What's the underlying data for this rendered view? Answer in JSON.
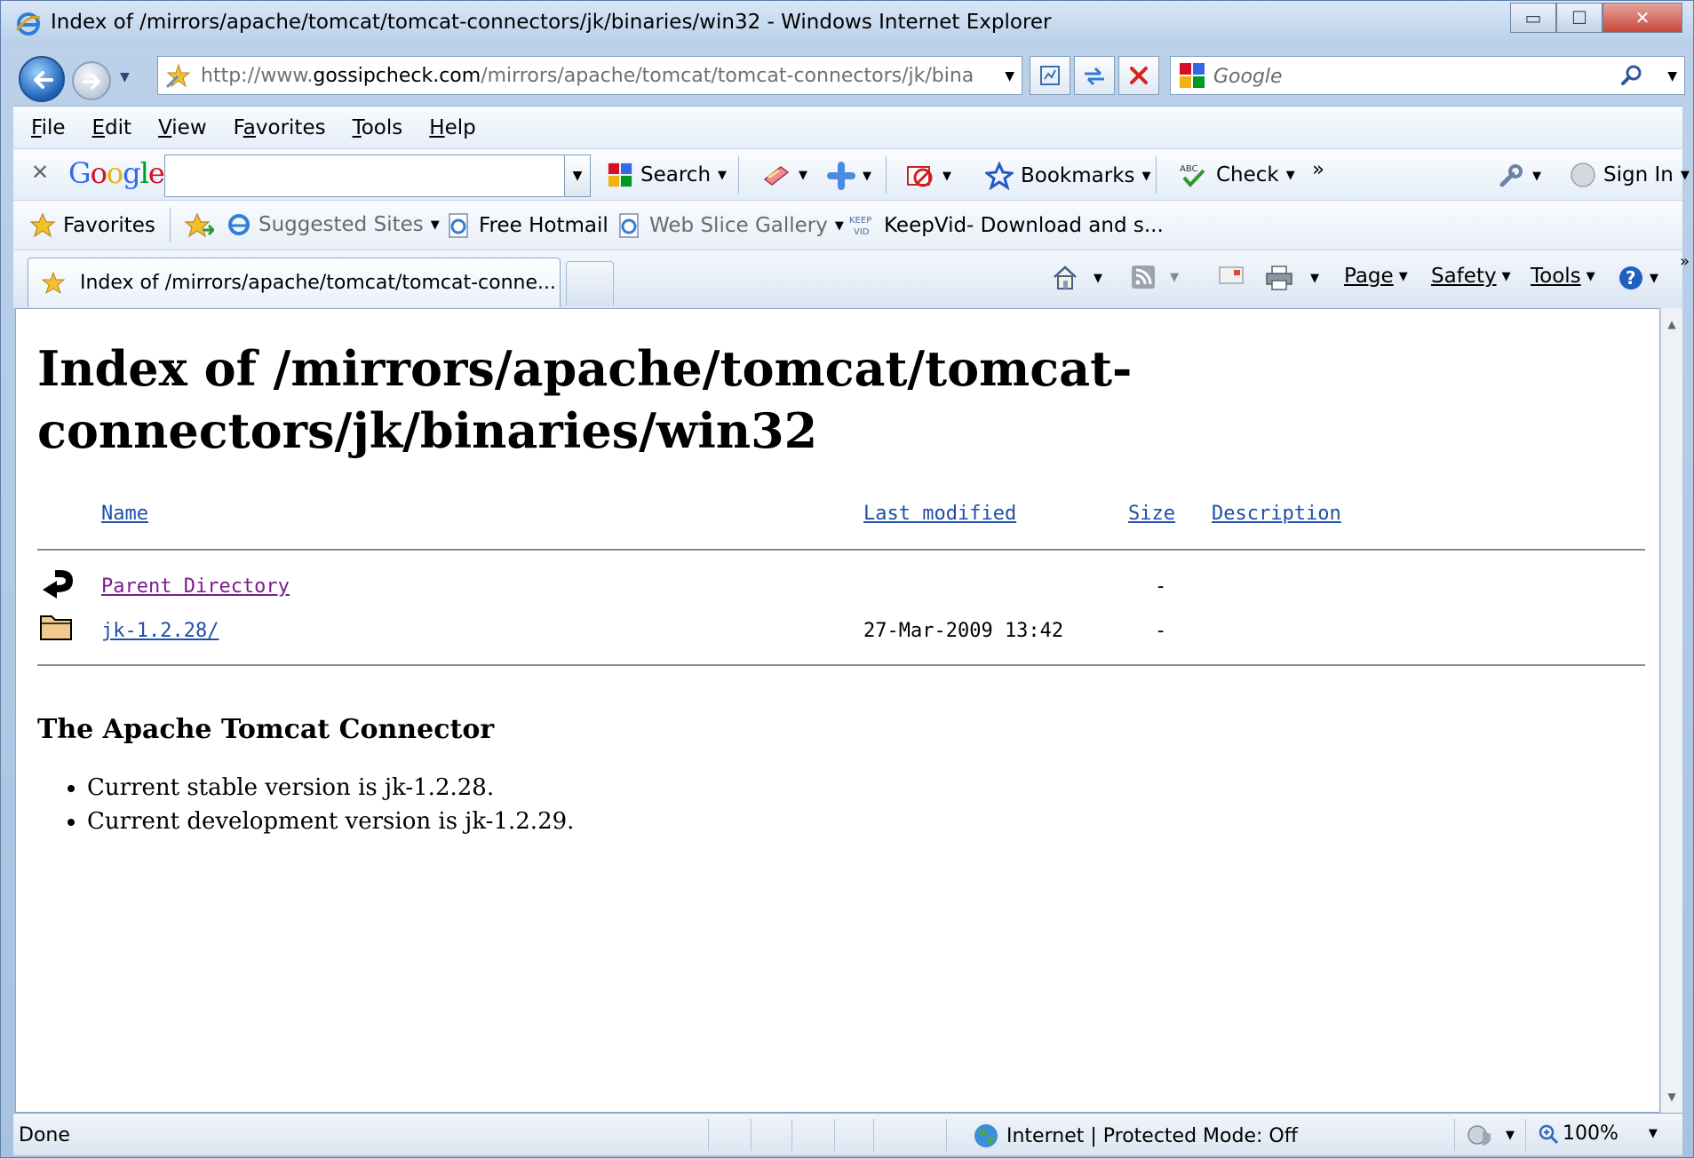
{
  "window": {
    "title": "Index of /mirrors/apache/tomcat/tomcat-connectors/jk/binaries/win32 - Windows Internet Explorer",
    "controls": {
      "minimize": "▭",
      "maximize": "☐",
      "close": "✕"
    }
  },
  "address": {
    "url_prefix": "http://www.",
    "url_host": "gossipcheck.com",
    "url_path": "/mirrors/apache/tomcat/tomcat-connectors/jk/binarie"
  },
  "search": {
    "placeholder": "Google"
  },
  "menu": [
    {
      "label": "File",
      "u": "F",
      "rest": "ile"
    },
    {
      "label": "Edit",
      "u": "E",
      "rest": "dit"
    },
    {
      "label": "View",
      "u": "V",
      "rest": "iew"
    },
    {
      "label": "Favorites",
      "u": "a",
      "pre": "F",
      "rest": "vorites"
    },
    {
      "label": "Tools",
      "u": "T",
      "rest": "ools"
    },
    {
      "label": "Help",
      "u": "H",
      "rest": "elp"
    }
  ],
  "google_toolbar": {
    "close": "✕",
    "logo": [
      "G",
      "o",
      "o",
      "g",
      "l",
      "e"
    ],
    "search_label": "Search",
    "bookmarks_label": "Bookmarks",
    "check_label": "Check",
    "more": "»",
    "sign_in_label": "Sign In"
  },
  "favorites_bar": {
    "favorites_label": "Favorites",
    "suggested_sites": "Suggested Sites",
    "free_hotmail": "Free Hotmail",
    "web_slice_gallery": "Web Slice Gallery",
    "keepvid": "KeepVid- Download and s..."
  },
  "tab": {
    "active_label": "Index of /mirrors/apache/tomcat/tomcat-conne..."
  },
  "command_bar": {
    "page_label": "Page",
    "safety_label": "Safety",
    "tools_label": "Tools",
    "more": "»"
  },
  "page": {
    "title_line1": "Index of /mirrors/apache/tomcat/tomcat-",
    "title_line2": "connectors/jk/binaries/win32",
    "columns": {
      "name": "Name",
      "last_modified": "Last modified",
      "size": "Size",
      "description": "Description"
    },
    "rows": [
      {
        "name": "Parent Directory",
        "date": "",
        "size": "-",
        "icon": "back-arrow-icon",
        "visited": true
      },
      {
        "name": "jk-1.2.28/",
        "date": "27-Mar-2009 13:42",
        "size": "-",
        "icon": "folder-icon",
        "visited": false
      }
    ],
    "section_title": "The Apache Tomcat Connector",
    "bullets": [
      "Current stable version is jk-1.2.28.",
      "Current development version is jk-1.2.29."
    ]
  },
  "status": {
    "text": "Done",
    "zone": "Internet | Protected Mode: Off",
    "zoom": "100%"
  },
  "colors": {
    "link": "#1f4fa8",
    "visited_link": "#7a1d8c",
    "google_blue": "#3369e8",
    "google_red": "#d50f25",
    "google_yellow": "#eeb211",
    "google_green": "#009925"
  }
}
